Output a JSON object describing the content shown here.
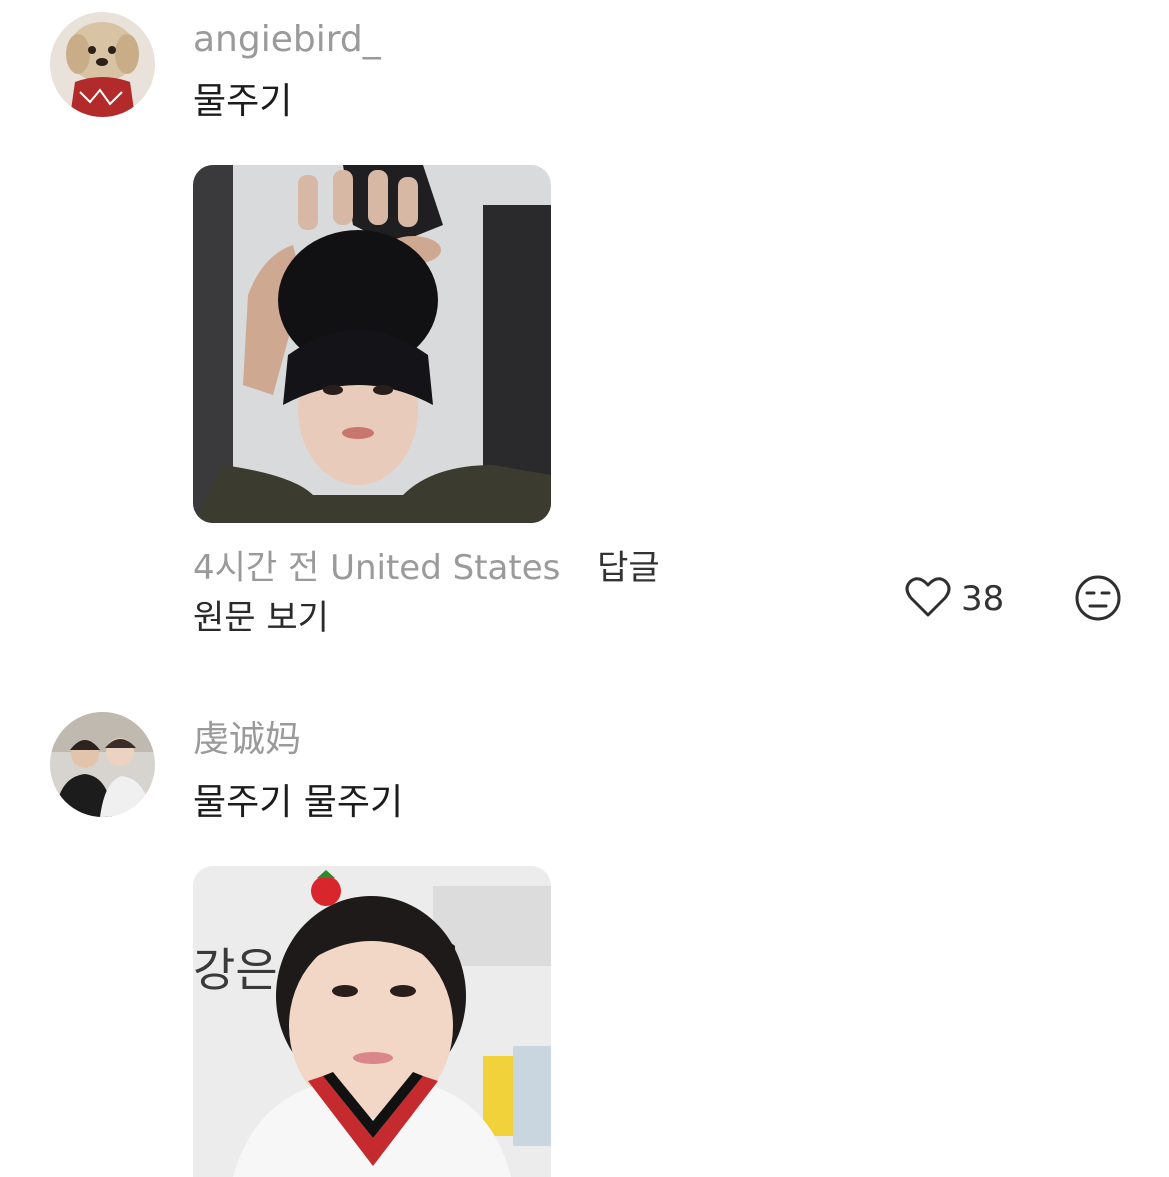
{
  "comments": [
    {
      "username": "angiebird_",
      "text": "물주기",
      "time": "4시간 전",
      "location": "United States",
      "reply_label": "답글",
      "view_original_label": "원문 보기",
      "likes": "38",
      "avatar_icon": "dog-avatar",
      "photo_desc": "photo-person-with-hands-on-head"
    },
    {
      "username": "虔诚妈",
      "text": "물주기 물주기",
      "avatar_icon": "two-people-avatar",
      "photo_desc": "photo-child-with-strawberry-clip"
    }
  ],
  "colors": {
    "username": "#9a9a9a",
    "text": "#1c1c1c",
    "meta": "#9a9a9a"
  },
  "icons": {
    "like": "heart-outline-icon",
    "reaction": "neutral-face-icon"
  }
}
